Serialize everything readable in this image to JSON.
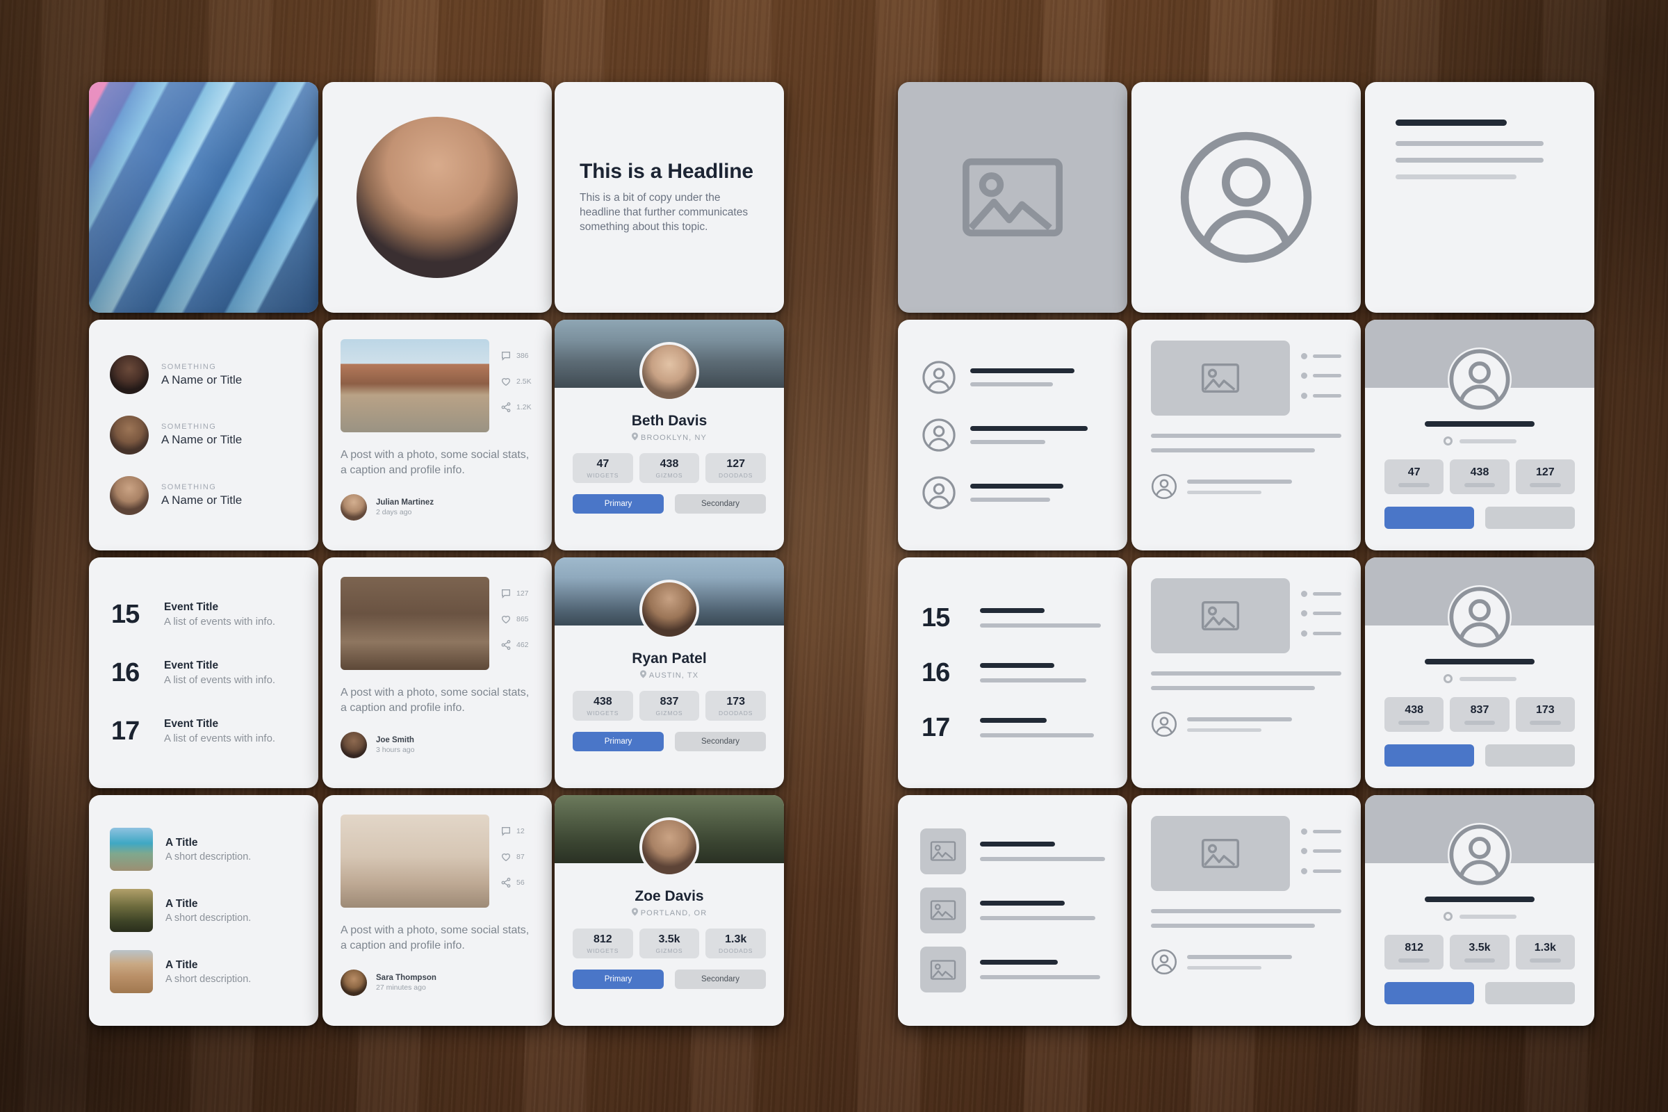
{
  "scene": {
    "description": "Photograph of printed UI component cards laid out on a dark wood desk",
    "background_color": "#5e3a21",
    "card_color": "#f2f3f5",
    "accent_color": "#4a76c8",
    "wireframe_gray": "#b9bcc2",
    "text_dark": "#1c2433",
    "text_muted": "#8b9199"
  },
  "left_group": {
    "media_card": {
      "icon": "abstract-gradient-artwork"
    },
    "avatar_card": {
      "icon": "portrait-photo-circle"
    },
    "headline_card": {
      "headline": "This is a Headline",
      "body": "This is a bit of copy under the headline that further communicates something about this topic."
    },
    "people_list_card": {
      "items": [
        {
          "eyebrow": "SOMETHING",
          "title": "A Name or Title",
          "avatar": "woman-avatar"
        },
        {
          "eyebrow": "SOMETHING",
          "title": "A Name or Title",
          "avatar": "man-avatar"
        },
        {
          "eyebrow": "SOMETHING",
          "title": "A Name or Title",
          "avatar": "man-glasses-avatar"
        }
      ]
    },
    "event_list_card": {
      "items": [
        {
          "day": "15",
          "title": "Event Title",
          "desc": "A list of events with info."
        },
        {
          "day": "16",
          "title": "Event Title",
          "desc": "A list of events with info."
        },
        {
          "day": "17",
          "title": "Event Title",
          "desc": "A list of events with info."
        }
      ]
    },
    "thumb_list_card": {
      "items": [
        {
          "title": "A Title",
          "desc": "A short description.",
          "thumb": "coast-photo"
        },
        {
          "title": "A Title",
          "desc": "A short description.",
          "thumb": "forest-photo"
        },
        {
          "title": "A Title",
          "desc": "A short description.",
          "thumb": "dune-photo"
        }
      ]
    },
    "post_cards": [
      {
        "image": "van-on-desert-road-photo",
        "caption": "A post with a photo, some social stats, a caption and profile info.",
        "author": "Julian Martinez",
        "time": "2 days ago",
        "stats": {
          "comments": "386",
          "likes": "2.5K",
          "shares": "1.2K"
        }
      },
      {
        "image": "woodworking-tools-photo",
        "caption": "A post with a photo, some social stats, a caption and profile info.",
        "author": "Joe Smith",
        "time": "3 hours ago",
        "stats": {
          "comments": "127",
          "likes": "865",
          "shares": "462"
        }
      },
      {
        "image": "bicycle-photo",
        "caption": "A post with a photo, some social stats, a caption and profile info.",
        "author": "Sara Thompson",
        "time": "27 minutes ago",
        "stats": {
          "comments": "12",
          "likes": "87",
          "shares": "56"
        }
      }
    ],
    "profile_cards": [
      {
        "cover": "bridge-photo",
        "avatar": "elder-man-glasses-avatar",
        "name": "Beth Davis",
        "location": "BROOKLYN, NY",
        "stats": [
          {
            "value": "47",
            "label": "WIDGETS"
          },
          {
            "value": "438",
            "label": "GIZMOS"
          },
          {
            "value": "127",
            "label": "DOODADS"
          }
        ],
        "primary_button": "Primary",
        "secondary_button": "Secondary"
      },
      {
        "cover": "city-skyline-photo",
        "avatar": "bearded-man-avatar",
        "name": "Ryan Patel",
        "location": "AUSTIN, TX",
        "stats": [
          {
            "value": "438",
            "label": "WIDGETS"
          },
          {
            "value": "837",
            "label": "GIZMOS"
          },
          {
            "value": "173",
            "label": "DOODADS"
          }
        ],
        "primary_button": "Primary",
        "secondary_button": "Secondary"
      },
      {
        "cover": "forest-photo",
        "avatar": "man-glasses-avatar",
        "name": "Zoe Davis",
        "location": "PORTLAND, OR",
        "stats": [
          {
            "value": "812",
            "label": "WIDGETS"
          },
          {
            "value": "3.5k",
            "label": "GIZMOS"
          },
          {
            "value": "1.3k",
            "label": "DOODADS"
          }
        ],
        "primary_button": "Primary",
        "secondary_button": "Secondary"
      }
    ]
  },
  "right_group": {
    "media_card": {
      "icon": "image-placeholder-icon"
    },
    "avatar_card": {
      "icon": "user-circle-icon"
    },
    "text_card": {
      "icon": "text-lines-placeholder"
    },
    "people_list_card": {
      "icon": "user-circle-icon",
      "rows": 3
    },
    "media_text_cards": {
      "icon": "image-placeholder-icon",
      "bullets": 3
    },
    "event_list_card": {
      "items": [
        {
          "day": "15"
        },
        {
          "day": "16"
        },
        {
          "day": "17"
        }
      ]
    },
    "thumb_list_card": {
      "icon": "image-placeholder-icon",
      "rows": 3
    },
    "profile_cards": [
      {
        "icon": "user-circle-icon",
        "stats": [
          {
            "value": "47"
          },
          {
            "value": "438"
          },
          {
            "value": "127"
          }
        ],
        "buttons": [
          "primary",
          "secondary"
        ]
      },
      {
        "icon": "user-circle-icon",
        "stats": [
          {
            "value": "438"
          },
          {
            "value": "837"
          },
          {
            "value": "173"
          }
        ],
        "buttons": [
          "primary",
          "secondary"
        ]
      },
      {
        "icon": "user-circle-icon",
        "stats": [
          {
            "value": "812"
          },
          {
            "value": "3.5k"
          },
          {
            "value": "1.3k"
          }
        ],
        "buttons": [
          "primary",
          "secondary"
        ]
      }
    ]
  }
}
